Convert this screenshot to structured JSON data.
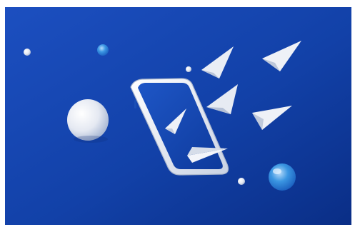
{
  "scene": {
    "background_colors": [
      "#1a49b8",
      "#0f3a9e",
      "#0b2f86"
    ],
    "phone": {
      "body_color": "#eef0f5",
      "screen_color": "#1546b3"
    },
    "spheres": [
      "white-sphere-large",
      "white-sphere-small",
      "white-dot",
      "white-dot",
      "blue-bubble",
      "blue-bubble-small"
    ],
    "planes": [
      "paper-plane-icon",
      "paper-plane-icon",
      "paper-plane-icon",
      "paper-plane-icon",
      "paper-plane-icon",
      "paper-plane-icon"
    ]
  }
}
